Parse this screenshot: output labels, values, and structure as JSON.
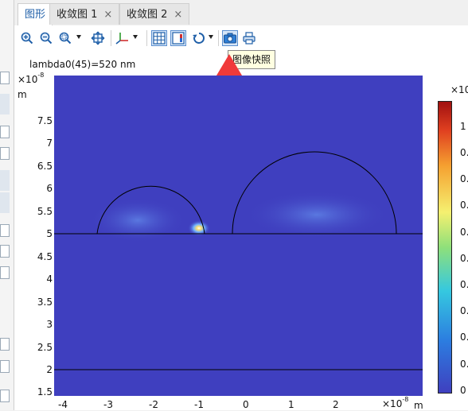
{
  "tabs": [
    {
      "label": "图形",
      "active": true,
      "closable": false
    },
    {
      "label": "收敛图 1",
      "active": false,
      "closable": true
    },
    {
      "label": "收敛图 2",
      "active": false,
      "closable": true
    }
  ],
  "close_glyph": "×",
  "toolbar_icons": [
    "zoom-in-icon",
    "zoom-out-icon",
    "zoom-box-icon",
    "zoom-extents-icon",
    "axis-orientation-icon",
    "show-grid-icon",
    "color-legend-icon",
    "rotate-icon",
    "camera-icon",
    "print-icon"
  ],
  "tooltip": "图像快照",
  "plot": {
    "title": "lambda0(45)=520 nm",
    "y_exponent_base": "×10",
    "y_exponent": "-8",
    "y_unit": "m",
    "x_exponent_base": "×10",
    "x_exponent": "-8",
    "x_unit": "m",
    "y_ticks": [
      "7.5",
      "7",
      "6.5",
      "6",
      "5.5",
      "5",
      "4.5",
      "4",
      "3.5",
      "3",
      "2.5",
      "2",
      "1.5"
    ],
    "x_ticks": [
      "-4",
      "-3",
      "-2",
      "-1",
      "0",
      "1",
      "2"
    ],
    "colorbar_label": "×10",
    "colorbar_ticks": [
      "1",
      "0.",
      "0.",
      "0.",
      "0.",
      "0.",
      "0.",
      "0.",
      "0.",
      "0.",
      "0"
    ],
    "background_color": "#3f3fbf",
    "arrow_color": "#f03a3a"
  }
}
